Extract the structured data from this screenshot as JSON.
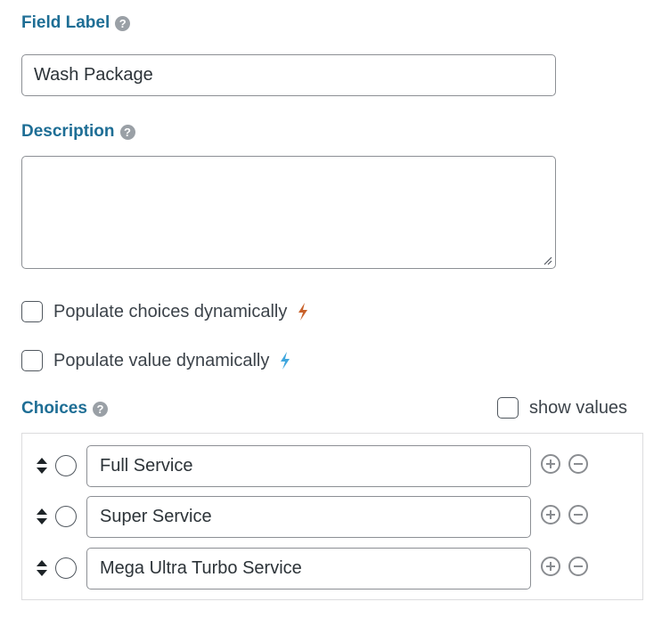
{
  "field_label": {
    "title": "Field Label",
    "help_icon": "question-circle-icon",
    "value": "Wash Package"
  },
  "description": {
    "title": "Description",
    "help_icon": "question-circle-icon",
    "value": ""
  },
  "options": {
    "populate_choices": {
      "label": "Populate choices dynamically",
      "checked": false,
      "icon": "bolt-icon",
      "icon_color": "#c8612a"
    },
    "populate_value": {
      "label": "Populate value dynamically",
      "checked": false,
      "icon": "bolt-icon",
      "icon_color": "#3fa6dd"
    }
  },
  "choices": {
    "title": "Choices",
    "help_icon": "question-circle-icon",
    "show_values_label": "show values",
    "show_values_checked": false,
    "items": [
      {
        "label": "Full Service"
      },
      {
        "label": "Super Service"
      },
      {
        "label": "Mega Ultra Turbo Service"
      }
    ]
  },
  "colors": {
    "label": "#1e6e95",
    "border": "#8c8f94",
    "icon_gray": "#8a8d91"
  }
}
